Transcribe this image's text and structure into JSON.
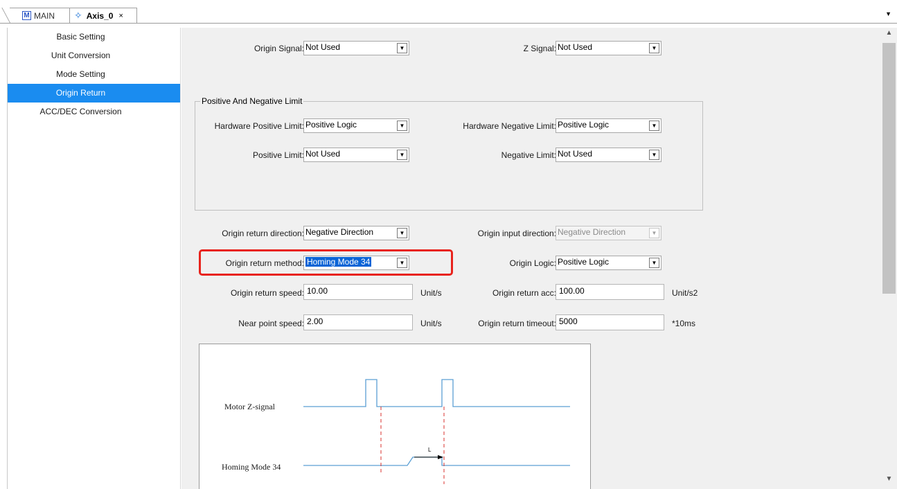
{
  "tabs": {
    "main_label": "MAIN",
    "axis_label": "Axis_0",
    "close_glyph": "×"
  },
  "sidebar": {
    "items": [
      {
        "label": "Basic Setting"
      },
      {
        "label": "Unit Conversion"
      },
      {
        "label": "Mode Setting"
      },
      {
        "label": "Origin Return"
      },
      {
        "label": "ACC/DEC Conversion"
      }
    ]
  },
  "form": {
    "origin_signal_label": "Origin Signal:",
    "origin_signal_value": "Not Used",
    "z_signal_label": "Z Signal:",
    "z_signal_value": "Not Used",
    "limit_group_title": "Positive And Negative Limit",
    "hw_pos_limit_label": "Hardware Positive Limit:",
    "hw_pos_limit_value": "Positive Logic",
    "hw_neg_limit_label": "Hardware Negative Limit:",
    "hw_neg_limit_value": "Positive Logic",
    "pos_limit_label": "Positive Limit:",
    "pos_limit_value": "Not Used",
    "neg_limit_label": "Negative Limit:",
    "neg_limit_value": "Not Used",
    "return_dir_label": "Origin return direction:",
    "return_dir_value": "Negative Direction",
    "input_dir_label": "Origin input direction:",
    "input_dir_value": "Negative Direction",
    "return_method_label": "Origin return method:",
    "return_method_value": "Homing Mode 34",
    "origin_logic_label": "Origin Logic:",
    "origin_logic_value": "Positive Logic",
    "return_speed_label": "Origin return speed:",
    "return_speed_value": "10.00",
    "return_speed_unit": "Unit/s",
    "return_acc_label": "Origin return acc:",
    "return_acc_value": "100.00",
    "return_acc_unit": "Unit/s2",
    "near_speed_label": "Near point speed:",
    "near_speed_value": "2.00",
    "near_speed_unit": "Unit/s",
    "timeout_label": "Origin return timeout:",
    "timeout_value": "5000",
    "timeout_unit": "*10ms"
  },
  "diagram": {
    "z_signal_label": "Motor Z-signal",
    "homing_label": "Homing Mode 34",
    "distance_label": "L"
  },
  "colors": {
    "accent": "#1a8cf0",
    "highlight_border": "#e8231c",
    "signal_line": "#5a9fd4",
    "dashed_marker": "#d9302c"
  }
}
